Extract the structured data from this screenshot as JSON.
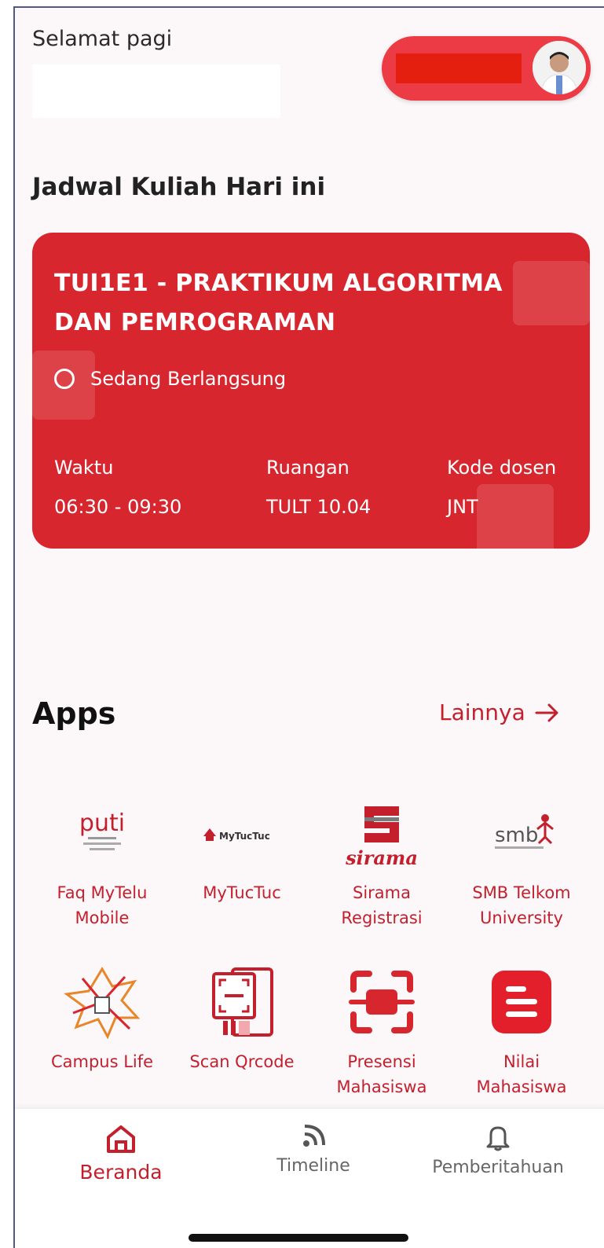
{
  "header": {
    "greeting": "Selamat pagi"
  },
  "schedule": {
    "section_title": "Jadwal Kuliah Hari ini",
    "course_title": "TUI1E1 - PRAKTIKUM ALGORITMA DAN PEMROGRAMAN",
    "status": "Sedang Berlangsung",
    "time_label": "Waktu",
    "time_value": "06:30 - 09:30",
    "room_label": "Ruangan",
    "room_value": "TULT 10.04",
    "lecturer_label": "Kode dosen",
    "lecturer_value": "JNT"
  },
  "apps": {
    "title": "Apps",
    "more_label": "Lainnya",
    "items": [
      {
        "label_1": "Faq MyTelu",
        "label_2": "Mobile",
        "icon": "puti-logo"
      },
      {
        "label_1": "MyTucTuc",
        "label_2": "",
        "icon": "mytuctuc-logo"
      },
      {
        "label_1": "Sirama",
        "label_2": "Registrasi",
        "icon": "sirama-logo"
      },
      {
        "label_1": "SMB Telkom",
        "label_2": "University",
        "icon": "smb-logo"
      },
      {
        "label_1": "Campus Life",
        "label_2": "",
        "icon": "campus-life-logo"
      },
      {
        "label_1": "Scan Qrcode",
        "label_2": "",
        "icon": "scan-qrcode-icon"
      },
      {
        "label_1": "Presensi",
        "label_2": "Mahasiswa",
        "icon": "presensi-scan-icon"
      },
      {
        "label_1": "Nilai",
        "label_2": "Mahasiswa",
        "icon": "nilai-icon"
      }
    ],
    "logo_text": {
      "puti": "puti",
      "mytuctuc": "MyTucTuc",
      "sirama": "sirama",
      "smb": "smb"
    }
  },
  "nav": {
    "home": "Beranda",
    "timeline": "Timeline",
    "notifications": "Pemberitahuan"
  },
  "colors": {
    "primary": "#d8262f",
    "accent_text": "#c41f2c"
  }
}
